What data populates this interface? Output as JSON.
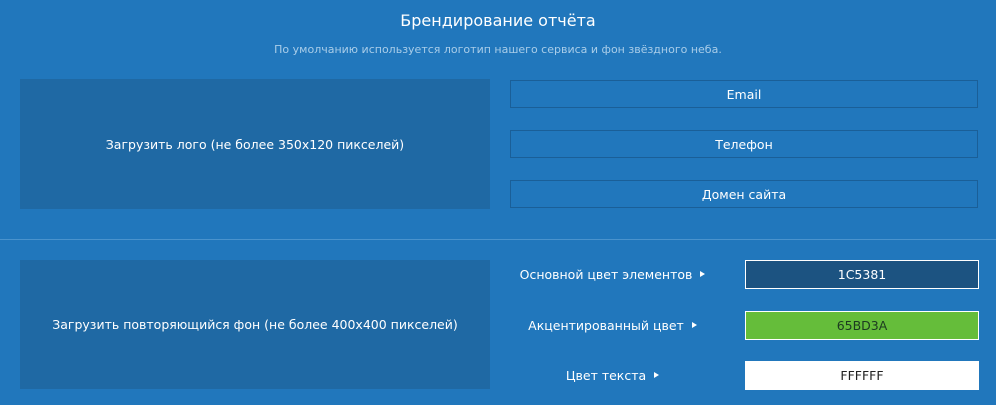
{
  "header": {
    "title": "Брендирование отчёта",
    "subtitle": "По умолчанию используется логотип нашего сервиса и фон звёздного неба."
  },
  "logo_upload": {
    "label": "Загрузить лого (не более 350x120 пикселей)"
  },
  "contact_fields": {
    "email_placeholder": "Email",
    "phone_placeholder": "Телефон",
    "domain_placeholder": "Домен сайта"
  },
  "background_upload": {
    "label": "Загрузить повторяющийся фон (не более 400x400 пикселей)"
  },
  "colors": [
    {
      "label": "Основной цвет элементов",
      "value": "1C5381",
      "hex": "#1C5381"
    },
    {
      "label": "Акцентированный цвет",
      "value": "65BD3A",
      "hex": "#65BD3A"
    },
    {
      "label": "Цвет текста",
      "value": "FFFFFF",
      "hex": "#FFFFFF"
    }
  ],
  "theme": {
    "background": "#2177bc",
    "panel": "#1f69a4",
    "subtitle_color": "#a9cde9"
  },
  "icons": {
    "color_label_arrow": "triangle-right-icon"
  }
}
